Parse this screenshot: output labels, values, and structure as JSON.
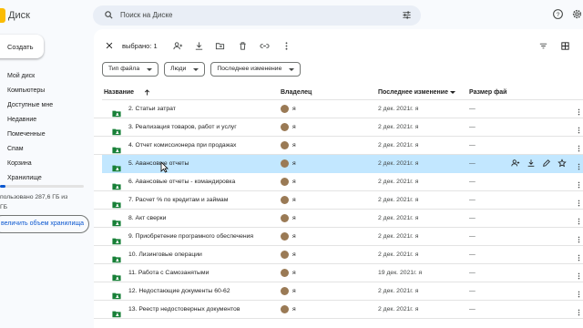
{
  "app": {
    "title": "Диск"
  },
  "search": {
    "placeholder": "Поиск на Диске"
  },
  "create_label": "Создать",
  "sidebar": {
    "items": [
      {
        "label": "Мой диск"
      },
      {
        "label": "Компьютеры"
      },
      {
        "label": "Доступные мне"
      },
      {
        "label": "Недавние"
      },
      {
        "label": "Помеченные"
      },
      {
        "label": "Спам"
      },
      {
        "label": "Корзина"
      },
      {
        "label": "Хранилище"
      }
    ],
    "storage_line1": "пользовано 287,6 ГБ из",
    "storage_line2": "ГБ",
    "storage_fraction": 0.07,
    "more_storage": "величить объем хранилища"
  },
  "selection": {
    "count_label": "выбрано: 1"
  },
  "filters": [
    {
      "label": "Тип файла"
    },
    {
      "label": "Люди"
    },
    {
      "label": "Последнее изменение"
    }
  ],
  "table": {
    "headers": {
      "name": "Название",
      "owner": "Владелец",
      "modified": "Последнее изменение",
      "size": "Размер фай"
    },
    "rows": [
      {
        "name": "2. Статьи затрат",
        "owner": "я",
        "modified": "2 дек. 2021г. я",
        "size": "—"
      },
      {
        "name": "3. Реализация товаров, работ и услуг",
        "owner": "я",
        "modified": "2 дек. 2021г. я",
        "size": "—"
      },
      {
        "name": "4. Отчет комиссионера при продажах",
        "owner": "я",
        "modified": "2 дек. 2021г. я",
        "size": "—"
      },
      {
        "name": "5. Авансовые отчеты",
        "owner": "я",
        "modified": "2 дек. 2021г. я",
        "size": "—"
      },
      {
        "name": "6. Авансовые отчеты - командировка",
        "owner": "я",
        "modified": "2 дек. 2021г. я",
        "size": "—"
      },
      {
        "name": "7. Расчет % по кредитам и займам",
        "owner": "я",
        "modified": "2 дек. 2021г. я",
        "size": "—"
      },
      {
        "name": "8. Акт сверки",
        "owner": "я",
        "modified": "2 дек. 2021г. я",
        "size": "—"
      },
      {
        "name": "9. Приобретение програмного обеспечения",
        "owner": "я",
        "modified": "2 дек. 2021г. я",
        "size": "—"
      },
      {
        "name": "10. Лизинговые операции",
        "owner": "я",
        "modified": "2 дек. 2021г. я",
        "size": "—"
      },
      {
        "name": "11. Работа с Самозанятыми",
        "owner": "я",
        "modified": "19 дек. 2021г. я",
        "size": "—"
      },
      {
        "name": "12. Недостающие документы 60-62",
        "owner": "я",
        "modified": "2 дек. 2021г. я",
        "size": "—"
      },
      {
        "name": "13. Реестр недостоверных документов",
        "owner": "я",
        "modified": "2 дек. 2021г. я",
        "size": "—"
      }
    ],
    "selected_index": 3
  },
  "colors": {
    "accent": "#0b57d0",
    "selected_row": "#c2e7ff",
    "folder": "#188038"
  }
}
